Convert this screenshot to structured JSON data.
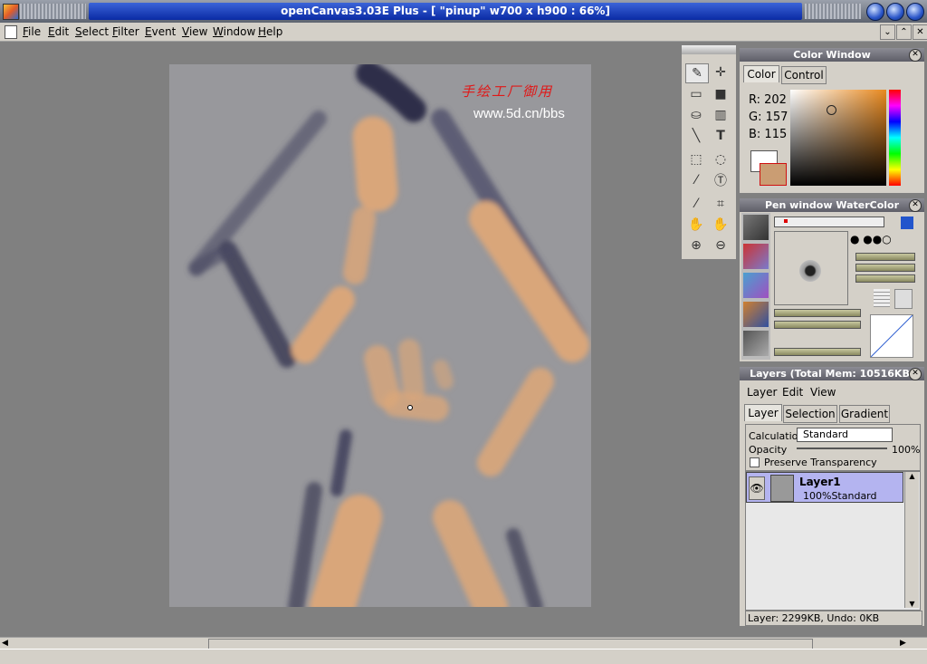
{
  "window": {
    "title": "openCanvas3.03E Plus - [ \"pinup\" w700 x h900 : 66%]"
  },
  "menubar": {
    "items": [
      "File",
      "Edit",
      "Select",
      "Filter",
      "Event",
      "View",
      "Window",
      "Help"
    ]
  },
  "canvas": {
    "watermark_cn": "手绘工厂御用",
    "watermark_url": "www.5d.cn/bbs",
    "colors": {
      "background": "#98989c",
      "skin": "#d9a67a",
      "shadow": "#3a3a55"
    }
  },
  "color_window": {
    "title": "Color Window",
    "tabs": [
      "Color",
      "Control"
    ],
    "r_label": "R: 202",
    "g_label": "G: 157",
    "b_label": "B: 115",
    "current_color": "#ca9d73"
  },
  "pen_window": {
    "title": "Pen window  WaterColor"
  },
  "layers": {
    "title": "Layers (Total Mem: 10516KB)",
    "menu": [
      "Layer",
      "Edit",
      "View"
    ],
    "tabs": [
      "Layer",
      "Selection",
      "Gradient"
    ],
    "calculation_label": "Calculation",
    "calculation_value": "Standard",
    "opacity_label": "Opacity",
    "opacity_value": "100%",
    "preserve_label": "Preserve Transparency",
    "layer_name": "Layer1",
    "layer_info": "100%Standard",
    "footer": "Layer: 2299KB, Undo: 0KB"
  },
  "icons": [
    "pen-icon",
    "move-icon",
    "rect-icon",
    "fill-icon",
    "bucket-icon",
    "gradient-icon",
    "line-icon",
    "text-icon",
    "select-rect-icon",
    "lasso-icon",
    "wand-icon",
    "text-select-icon",
    "eyedropper-icon",
    "crop-icon",
    "hand-icon",
    "rotate-hand-icon",
    "zoom-in-icon",
    "zoom-out-icon"
  ]
}
